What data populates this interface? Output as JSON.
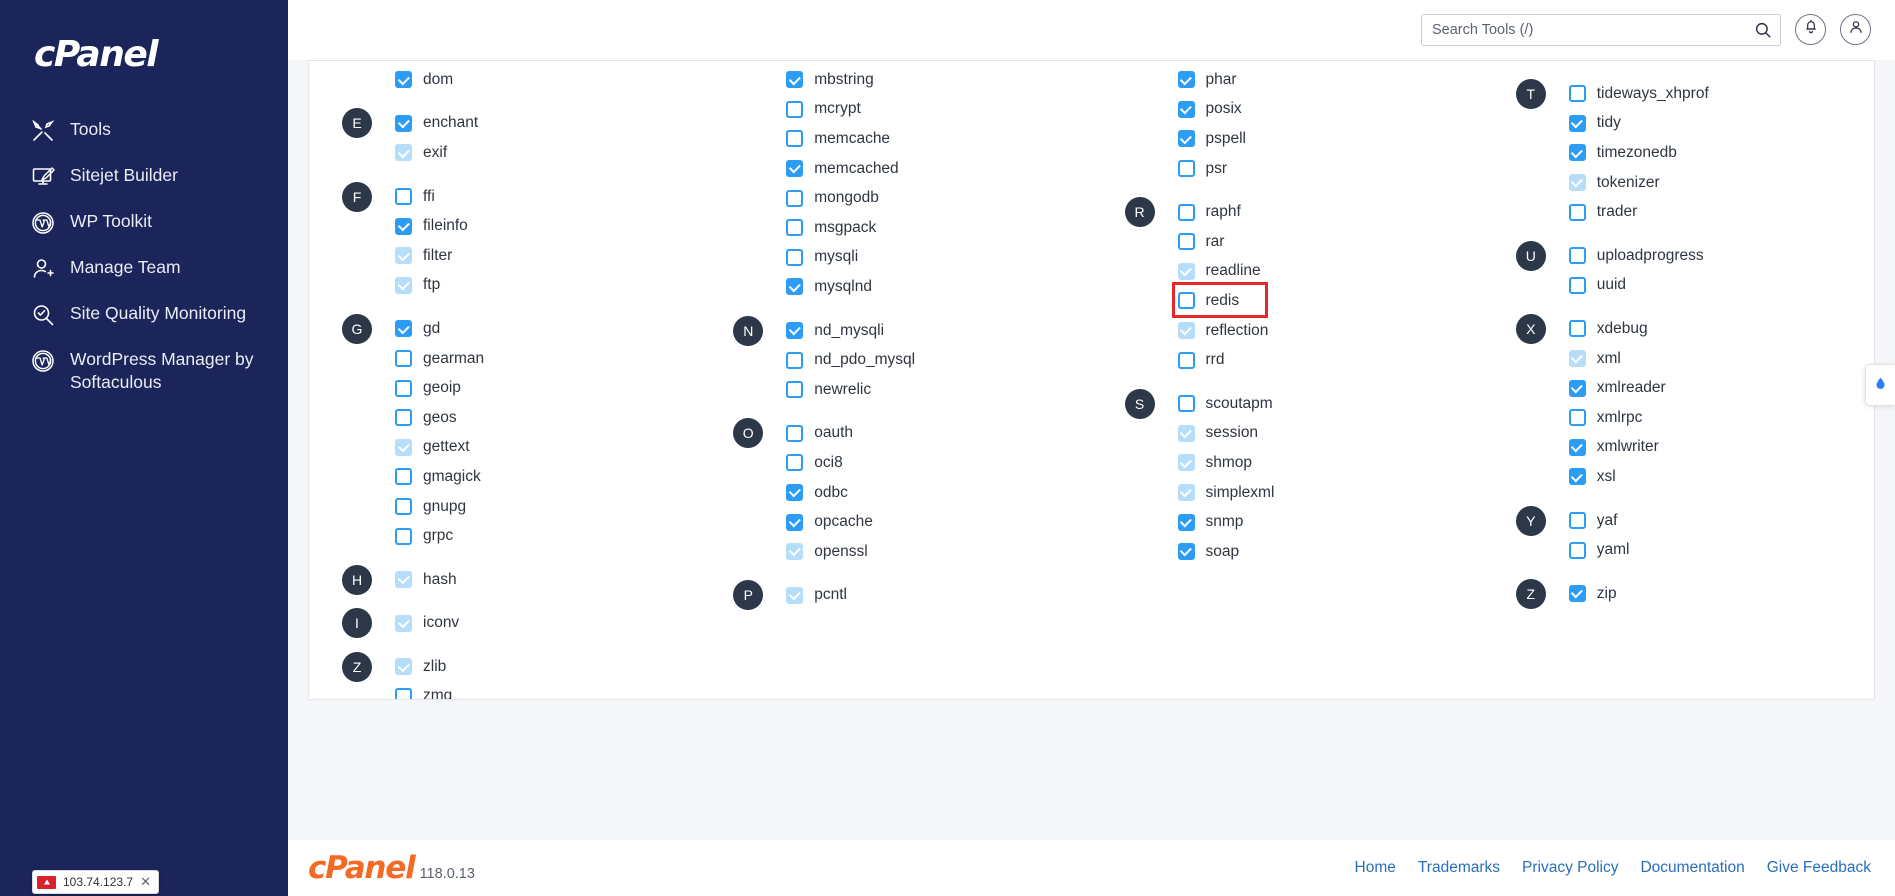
{
  "sidebar": {
    "brand": "cPanel",
    "items": [
      {
        "label": "Tools",
        "icon": "tools-icon"
      },
      {
        "label": "Sitejet Builder",
        "icon": "monitor-pen-icon"
      },
      {
        "label": "WP Toolkit",
        "icon": "wordpress-icon"
      },
      {
        "label": "Manage Team",
        "icon": "user-plus-icon"
      },
      {
        "label": "Site Quality Monitoring",
        "icon": "magnifier-check-icon"
      },
      {
        "label": "WordPress Manager by Softaculous",
        "icon": "wordpress-icon"
      }
    ],
    "ip_badge": {
      "ip": "103.74.123.7",
      "close": "✕"
    }
  },
  "header": {
    "search_placeholder": "Search Tools (/)",
    "search_value": "",
    "search_icon": "search-icon",
    "notifications_icon": "bell-icon",
    "account_icon": "user-icon"
  },
  "extensions": {
    "highlighted": "redis",
    "columns": [
      {
        "items": [
          {
            "letter": "",
            "name": "dom",
            "state": "checked"
          },
          {
            "letter": "E",
            "name": "enchant",
            "state": "checked"
          },
          {
            "letter": "",
            "name": "exif",
            "state": "locked"
          },
          {
            "letter": "F",
            "name": "ffi",
            "state": "unchecked"
          },
          {
            "letter": "",
            "name": "fileinfo",
            "state": "checked"
          },
          {
            "letter": "",
            "name": "filter",
            "state": "locked"
          },
          {
            "letter": "",
            "name": "ftp",
            "state": "locked"
          },
          {
            "letter": "G",
            "name": "gd",
            "state": "checked"
          },
          {
            "letter": "",
            "name": "gearman",
            "state": "unchecked"
          },
          {
            "letter": "",
            "name": "geoip",
            "state": "unchecked"
          },
          {
            "letter": "",
            "name": "geos",
            "state": "unchecked"
          },
          {
            "letter": "",
            "name": "gettext",
            "state": "locked"
          },
          {
            "letter": "",
            "name": "gmagick",
            "state": "unchecked"
          },
          {
            "letter": "",
            "name": "gnupg",
            "state": "unchecked"
          },
          {
            "letter": "",
            "name": "grpc",
            "state": "unchecked"
          },
          {
            "letter": "H",
            "name": "hash",
            "state": "locked"
          },
          {
            "letter": "I",
            "name": "iconv",
            "state": "locked"
          },
          {
            "letter": "Z",
            "name": "zlib",
            "state": "locked"
          },
          {
            "letter": "",
            "name": "zmq",
            "state": "unchecked"
          }
        ]
      },
      {
        "items": [
          {
            "letter": "",
            "name": "mbstring",
            "state": "checked"
          },
          {
            "letter": "",
            "name": "mcrypt",
            "state": "unchecked"
          },
          {
            "letter": "",
            "name": "memcache",
            "state": "unchecked"
          },
          {
            "letter": "",
            "name": "memcached",
            "state": "checked"
          },
          {
            "letter": "",
            "name": "mongodb",
            "state": "unchecked"
          },
          {
            "letter": "",
            "name": "msgpack",
            "state": "unchecked"
          },
          {
            "letter": "",
            "name": "mysqli",
            "state": "unchecked"
          },
          {
            "letter": "",
            "name": "mysqlnd",
            "state": "checked"
          },
          {
            "letter": "N",
            "name": "nd_mysqli",
            "state": "checked"
          },
          {
            "letter": "",
            "name": "nd_pdo_mysql",
            "state": "unchecked"
          },
          {
            "letter": "",
            "name": "newrelic",
            "state": "unchecked"
          },
          {
            "letter": "O",
            "name": "oauth",
            "state": "unchecked"
          },
          {
            "letter": "",
            "name": "oci8",
            "state": "unchecked"
          },
          {
            "letter": "",
            "name": "odbc",
            "state": "checked"
          },
          {
            "letter": "",
            "name": "opcache",
            "state": "checked"
          },
          {
            "letter": "",
            "name": "openssl",
            "state": "locked"
          },
          {
            "letter": "P",
            "name": "pcntl",
            "state": "locked"
          }
        ]
      },
      {
        "items": [
          {
            "letter": "",
            "name": "phar",
            "state": "checked"
          },
          {
            "letter": "",
            "name": "posix",
            "state": "checked"
          },
          {
            "letter": "",
            "name": "pspell",
            "state": "checked"
          },
          {
            "letter": "",
            "name": "psr",
            "state": "unchecked"
          },
          {
            "letter": "R",
            "name": "raphf",
            "state": "unchecked"
          },
          {
            "letter": "",
            "name": "rar",
            "state": "unchecked"
          },
          {
            "letter": "",
            "name": "readline",
            "state": "locked"
          },
          {
            "letter": "",
            "name": "redis",
            "state": "unchecked"
          },
          {
            "letter": "",
            "name": "reflection",
            "state": "locked"
          },
          {
            "letter": "",
            "name": "rrd",
            "state": "unchecked"
          },
          {
            "letter": "S",
            "name": "scoutapm",
            "state": "unchecked"
          },
          {
            "letter": "",
            "name": "session",
            "state": "locked"
          },
          {
            "letter": "",
            "name": "shmop",
            "state": "locked"
          },
          {
            "letter": "",
            "name": "simplexml",
            "state": "locked"
          },
          {
            "letter": "",
            "name": "snmp",
            "state": "checked"
          },
          {
            "letter": "",
            "name": "soap",
            "state": "checked"
          }
        ]
      },
      {
        "items": [
          {
            "letter": "T",
            "name": "tideways_xhprof",
            "state": "unchecked"
          },
          {
            "letter": "",
            "name": "tidy",
            "state": "checked"
          },
          {
            "letter": "",
            "name": "timezonedb",
            "state": "checked"
          },
          {
            "letter": "",
            "name": "tokenizer",
            "state": "locked"
          },
          {
            "letter": "",
            "name": "trader",
            "state": "unchecked"
          },
          {
            "letter": "U",
            "name": "uploadprogress",
            "state": "unchecked"
          },
          {
            "letter": "",
            "name": "uuid",
            "state": "unchecked"
          },
          {
            "letter": "X",
            "name": "xdebug",
            "state": "unchecked"
          },
          {
            "letter": "",
            "name": "xml",
            "state": "locked"
          },
          {
            "letter": "",
            "name": "xmlreader",
            "state": "checked"
          },
          {
            "letter": "",
            "name": "xmlrpc",
            "state": "unchecked"
          },
          {
            "letter": "",
            "name": "xmlwriter",
            "state": "checked"
          },
          {
            "letter": "",
            "name": "xsl",
            "state": "checked"
          },
          {
            "letter": "Y",
            "name": "yaf",
            "state": "unchecked"
          },
          {
            "letter": "",
            "name": "yaml",
            "state": "unchecked"
          },
          {
            "letter": "Z",
            "name": "zip",
            "state": "checked"
          }
        ]
      }
    ]
  },
  "footer": {
    "logo": "cPanel",
    "version": "118.0.13",
    "links": [
      "Home",
      "Trademarks",
      "Privacy Policy",
      "Documentation",
      "Give Feedback"
    ]
  },
  "side_widget": {
    "icon": "water-drop-icon"
  },
  "colors": {
    "sidebar_bg": "#1b2559",
    "accent_blue": "#2d9cf5",
    "locked_blue": "#b6ddfa",
    "highlight_red": "#e8272b",
    "link_blue": "#2a6ebb",
    "cpanel_orange": "#f26a24",
    "teal_edge": "#3ec9c4"
  }
}
